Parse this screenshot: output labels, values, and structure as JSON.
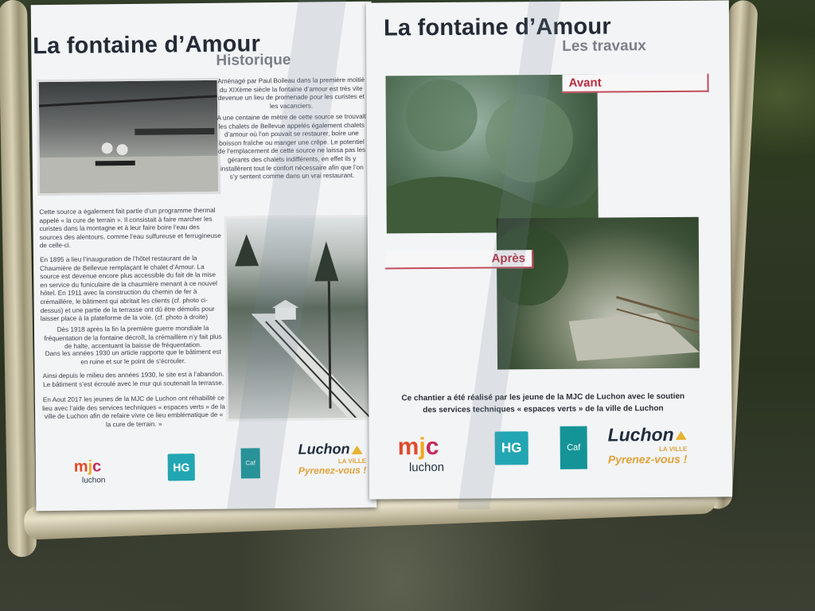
{
  "left": {
    "title": "La fontaine d’Amour",
    "subtitle": "Historique",
    "intro": "Aménagé par Paul Boileau dans la première moitié du XIXème siècle la fontaine d’amour est très vite devenue un lieu de promenade pour les curistes et les vacanciers.",
    "para2": "A une centaine de mètre de cette source se trouvait les chalets de Bellevue appelés également chalets d’amour où l’on pouvait se restaurer, boire une boisson fraîche ou manger une crêpe. Le potentiel de l’emplacement de cette source ne laissa pas les gérants des chalets indifférents, en effet ils y installèrent tout le confort nécessaire afin que l’on s’y sentent comme dans un vrai restaurant.",
    "para3": "Cette source a également fait partie d’un programme thermal appelé « la cure de terrain ». Il consistait à faire marcher les curistes dans la montagne et à leur faire boire l’eau des sources des alentours, comme l’eau sulfureuse et ferrugineuse de celle-ci.",
    "para4": "En 1895 a lieu l’inauguration de l’hôtel restaurant de la Chaumière de Bellevue remplaçant le chalet d’Amour. La source est devenue encore plus accessible du fait de la mise en service du funiculaire de la chaumière menant à ce nouvel hôtel. En 1911 avec la construction du chemin de fer à crémaillère, le bâtiment qui abritait les clients (cf. photo ci-dessus) et une partie de la terrasse ont dû être démolis pour laisser place à la plateforme de la voie. (cf. photo à droite)",
    "para5": "Dès 1918 après la fin la première guerre mondiale la fréquentation de la fontaine décroît, la crémaillère n’y fait plus de halte, accentuant la baisse de fréquentation.",
    "para6": "Dans les années 1930 un article rapporte que le bâtiment est en ruine et sur le point de s’écrouler.",
    "para7": "Ainsi depuis le milieu des années 1930, le site est à l’abandon. Le bâtiment s’est écroulé avec le mur qui soutenait la terrasse.",
    "para8": "En Aout 2017 les jeunes de la MJC de Luchon ont réhabilité ce lieu avec l’aide des services techniques « espaces verts » de la ville de Luchon afin de refaire vivre ce lieu emblématique de « la cure de terrain. »"
  },
  "right": {
    "title": "La fontaine d’Amour",
    "subtitle": "Les travaux",
    "avant": "Avant",
    "apres": "Après",
    "caption": "Ce chantier a été réalisé par les jeune de la MJC de Luchon avec le soutien des services techniques « espaces verts » de la ville de Luchon"
  },
  "logos": {
    "mjc_sub": "luchon",
    "hg": "HG",
    "caf": "Caf",
    "luchon": "Luchon",
    "ville": "LA VILLE",
    "slogan": "Pyrenez-vous !"
  }
}
